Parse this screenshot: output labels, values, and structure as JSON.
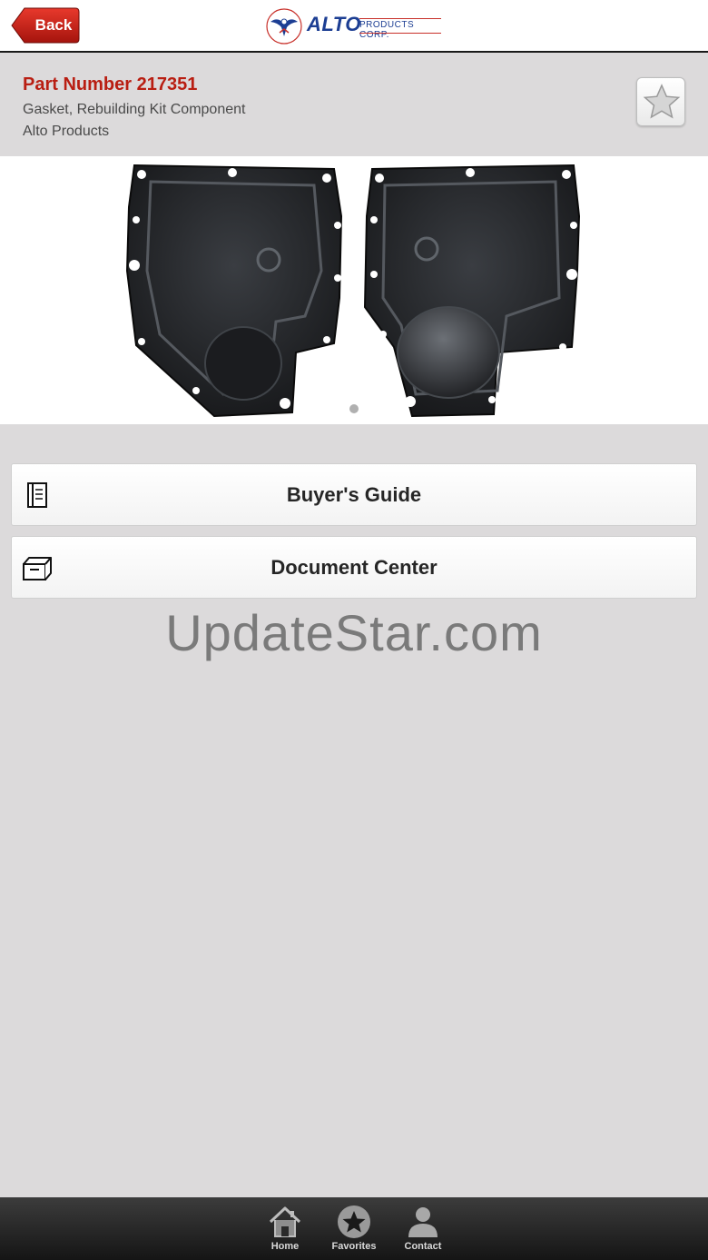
{
  "header": {
    "back_label": "Back",
    "logo_brand": "ALTO",
    "logo_corp": "PRODUCTS CORP.",
    "logo_seal_text": "ALTO PRODUCTS CORP."
  },
  "part": {
    "number_label": "Part Number 217351",
    "description": "Gasket, Rebuilding Kit Component",
    "brand": "Alto Products"
  },
  "gallery": {
    "image_count": 1,
    "current_page": 1
  },
  "actions": [
    {
      "label": "Buyer's Guide",
      "icon": "document-icon"
    },
    {
      "label": "Document Center",
      "icon": "box-icon"
    }
  ],
  "watermark": "UpdateStar.com",
  "tabbar": {
    "items": [
      {
        "label": "Home",
        "icon": "home-icon"
      },
      {
        "label": "Favorites",
        "icon": "star-icon"
      },
      {
        "label": "Contact",
        "icon": "person-icon"
      }
    ]
  },
  "colors": {
    "accent_red": "#b91e12",
    "background": "#dcdadb",
    "logo_blue": "#1c3e93"
  }
}
